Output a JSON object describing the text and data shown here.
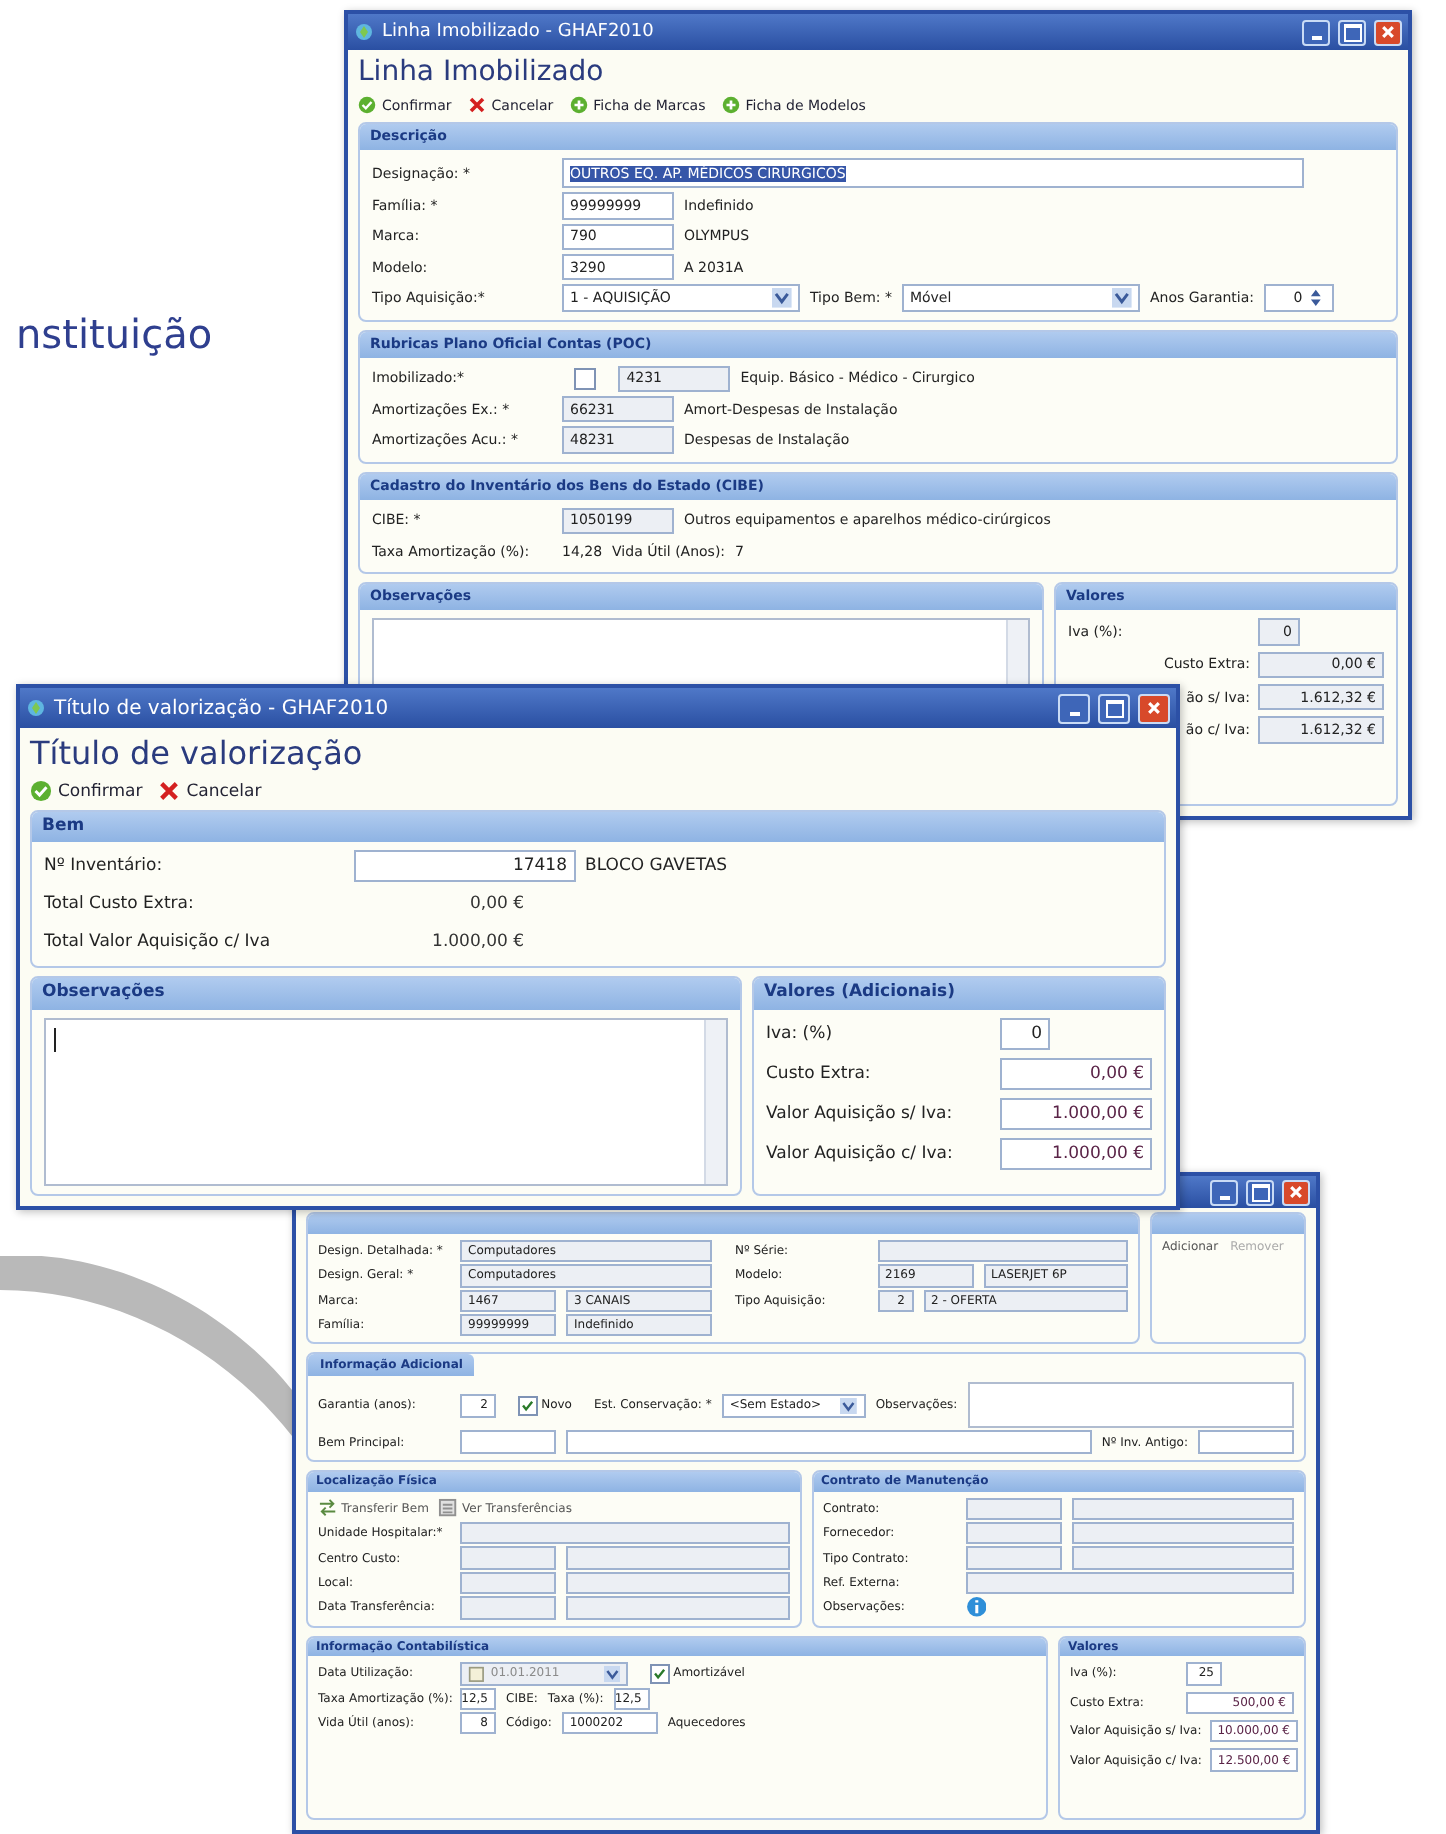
{
  "background_text": "nstituição",
  "windows": [
    {
      "title": "Linha Imobilizado - GHAF2010",
      "heading": "Linha Imobilizado",
      "toolbar": [
        {
          "kind": "confirm",
          "label": "Confirmar"
        },
        {
          "kind": "cancel",
          "label": "Cancelar"
        },
        {
          "kind": "open",
          "label": "Ficha de Marcas"
        },
        {
          "kind": "open",
          "label": "Ficha de Modelos"
        }
      ],
      "bands": [
        [
          {
            "kind": "form",
            "title": "Descrição",
            "readonly": false,
            "columns": [
              [
                [
                  {
                    "kind": "label",
                    "text": "Designação: *"
                  },
                  {
                    "kind": "input",
                    "value": "OUTROS EQ. AP. MÉDICOS CIRÚRGICOS",
                    "highlighted": true
                  }
                ],
                [
                  {
                    "kind": "label",
                    "text": "Família: *"
                  },
                  {
                    "kind": "code",
                    "value": "99999999"
                  },
                  {
                    "kind": "text",
                    "text": "Indefinido"
                  }
                ],
                [
                  {
                    "kind": "label",
                    "text": "Marca:"
                  },
                  {
                    "kind": "code",
                    "value": "790"
                  },
                  {
                    "kind": "text",
                    "text": "OLYMPUS"
                  }
                ],
                [
                  {
                    "kind": "label",
                    "text": "Modelo:"
                  },
                  {
                    "kind": "code",
                    "value": "3290"
                  },
                  {
                    "kind": "text",
                    "text": "A 2031A"
                  }
                ],
                [
                  {
                    "kind": "label",
                    "text": "Tipo Aquisição:*"
                  },
                  {
                    "kind": "select",
                    "value": "1 - AQUISIÇÃO"
                  },
                  {
                    "kind": "caption",
                    "text": "Tipo Bem: *"
                  },
                  {
                    "kind": "select",
                    "value": "Móvel"
                  },
                  {
                    "kind": "caption",
                    "text": "Anos Garantia:"
                  },
                  {
                    "kind": "spin",
                    "value": "0"
                  }
                ]
              ]
            ]
          }
        ],
        [
          {
            "kind": "form",
            "title": "Rubricas Plano Oficial Contas (POC)",
            "readonly": true,
            "columns": [
              [
                [
                  {
                    "kind": "label",
                    "text": "Imobilizado:*"
                  },
                  {
                    "kind": "check",
                    "checked": false
                  },
                  {
                    "kind": "code",
                    "value": "4231"
                  },
                  {
                    "kind": "text",
                    "text": "Equip. Básico - Médico - Cirurgico"
                  }
                ],
                [
                  {
                    "kind": "label",
                    "text": "Amortizações Ex.: *"
                  },
                  {
                    "kind": "code",
                    "value": "66231"
                  },
                  {
                    "kind": "text",
                    "text": "Amort-Despesas de Instalação"
                  }
                ],
                [
                  {
                    "kind": "label",
                    "text": "Amortizações Acu.: *"
                  },
                  {
                    "kind": "code",
                    "value": "48231"
                  },
                  {
                    "kind": "text",
                    "text": "Despesas de Instalação"
                  }
                ]
              ]
            ]
          }
        ],
        [
          {
            "kind": "form",
            "title": "Cadastro do Inventário dos Bens do Estado (CIBE)",
            "readonly": true,
            "columns": [
              [
                [
                  {
                    "kind": "label",
                    "text": "CIBE: *"
                  },
                  {
                    "kind": "code",
                    "value": "1050199"
                  },
                  {
                    "kind": "text",
                    "text": "Outros equipamentos e aparelhos médico-cirúrgicos"
                  }
                ],
                [
                  {
                    "kind": "label",
                    "text": "Taxa Amortização (%):"
                  },
                  {
                    "kind": "text",
                    "text": "14,28"
                  },
                  {
                    "kind": "caption",
                    "text": "Vida Útil (Anos):"
                  },
                  {
                    "kind": "text",
                    "text": "7"
                  }
                ]
              ]
            ]
          }
        ],
        [
          {
            "kind": "notes",
            "title": "Observações",
            "caret": false
          },
          {
            "kind": "values",
            "title": "Valores",
            "readonly": true,
            "items": [
              {
                "kind": "percent",
                "label": "Iva (%):",
                "value": "0"
              },
              {
                "kind": "money",
                "label": "Custo Extra:",
                "value": "0,00 €"
              },
              {
                "kind": "money",
                "label": "ão s/ Iva:",
                "value": "1.612,32 €"
              },
              {
                "kind": "money",
                "label": "ão c/ Iva:",
                "value": "1.612,32 €"
              }
            ]
          }
        ]
      ]
    },
    {
      "title": "Título de valorização - GHAF2010",
      "heading": "Título de valorização",
      "toolbar": [
        {
          "kind": "confirm",
          "label": "Confirmar"
        },
        {
          "kind": "cancel",
          "label": "Cancelar"
        }
      ],
      "bands": [
        [
          {
            "kind": "form",
            "title": "Bem",
            "readonly": false,
            "columns": [
              [
                [
                  {
                    "kind": "label",
                    "text": "Nº Inventário:"
                  },
                  {
                    "kind": "number",
                    "value": "17418"
                  },
                  {
                    "kind": "text",
                    "text": "BLOCO GAVETAS"
                  }
                ],
                [
                  {
                    "kind": "label",
                    "text": "Total Custo Extra:"
                  },
                  {
                    "kind": "amount",
                    "text": "0,00 €"
                  }
                ],
                [
                  {
                    "kind": "label",
                    "text": "Total Valor Aquisição c/ Iva"
                  },
                  {
                    "kind": "amount",
                    "text": "1.000,00 €"
                  }
                ]
              ]
            ]
          }
        ],
        [
          {
            "kind": "notes",
            "title": "Observações",
            "caret": true
          },
          {
            "kind": "values",
            "title": "Valores (Adicionais)",
            "readonly": false,
            "items": [
              {
                "kind": "percent",
                "label": "Iva: (%)",
                "value": "0"
              },
              {
                "kind": "money",
                "label": "Custo Extra:",
                "value": "0,00 €"
              },
              {
                "kind": "money",
                "label": "Valor Aquisição s/ Iva:",
                "value": "1.000,00 €"
              },
              {
                "kind": "money",
                "label": "Valor Aquisição c/ Iva:",
                "value": "1.000,00 €"
              }
            ]
          }
        ]
      ]
    },
    {
      "bands": [
        [
          {
            "kind": "form",
            "readonly": true,
            "columns": [
              [
                [
                  {
                    "kind": "label",
                    "text": "Design. Detalhada: *"
                  },
                  {
                    "kind": "input",
                    "value": "Computadores"
                  }
                ],
                [
                  {
                    "kind": "label",
                    "text": "Design. Geral: *"
                  },
                  {
                    "kind": "input",
                    "value": "Computadores"
                  }
                ],
                [
                  {
                    "kind": "label",
                    "text": "Marca:"
                  },
                  {
                    "kind": "code",
                    "value": "1467"
                  },
                  {
                    "kind": "input",
                    "value": "3 CANAIS"
                  }
                ],
                [
                  {
                    "kind": "label",
                    "text": "Família:"
                  },
                  {
                    "kind": "code",
                    "value": "99999999"
                  },
                  {
                    "kind": "input",
                    "value": "Indefinido"
                  }
                ]
              ],
              [
                [
                  {
                    "kind": "label",
                    "text": "Nº Série:"
                  },
                  {
                    "kind": "input"
                  }
                ],
                [
                  {
                    "kind": "label",
                    "text": "Modelo:"
                  },
                  {
                    "kind": "code",
                    "value": "2169"
                  },
                  {
                    "kind": "input",
                    "value": "LASERJET 6P"
                  }
                ],
                [
                  {
                    "kind": "label",
                    "text": "Tipo Aquisição:"
                  },
                  {
                    "kind": "short",
                    "value": "2"
                  },
                  {
                    "kind": "input",
                    "value": "2 - OFERTA"
                  }
                ]
              ]
            ]
          },
          {
            "kind": "attachments",
            "actions": [
              {
                "label": "Adicionar",
                "disabled": false
              },
              {
                "label": "Remover",
                "disabled": true
              }
            ]
          }
        ],
        [
          {
            "kind": "tab",
            "title": "Informação Adicional",
            "readonly": false,
            "columns": [
              [
                [
                  {
                    "kind": "label",
                    "text": "Garantia (anos):"
                  },
                  {
                    "kind": "short",
                    "value": "2"
                  },
                  {
                    "kind": "check",
                    "checked": true,
                    "label": "Novo"
                  },
                  {
                    "kind": "caption",
                    "text": "Est. Conservação: *"
                  },
                  {
                    "kind": "select",
                    "value": "<Sem Estado>"
                  },
                  {
                    "kind": "caption",
                    "text": "Observações:"
                  },
                  {
                    "kind": "memo"
                  }
                ],
                [
                  {
                    "kind": "label",
                    "text": "Bem Principal:"
                  },
                  {
                    "kind": "code"
                  },
                  {
                    "kind": "input"
                  },
                  {
                    "kind": "caption",
                    "text": "Nº Inv. Antigo:"
                  },
                  {
                    "kind": "code"
                  }
                ]
              ]
            ]
          }
        ],
        [
          {
            "kind": "form",
            "title": "Localização Física",
            "readonly": true,
            "columns": [
              [
                [
                  {
                    "kind": "transfer",
                    "text": "Transferir Bem"
                  },
                  {
                    "kind": "history",
                    "text": "Ver Transferências"
                  }
                ],
                [
                  {
                    "kind": "label",
                    "text": "Unidade Hospitalar:*"
                  },
                  {
                    "kind": "input"
                  }
                ],
                [
                  {
                    "kind": "label",
                    "text": "Centro Custo:"
                  },
                  {
                    "kind": "code"
                  },
                  {
                    "kind": "input"
                  }
                ],
                [
                  {
                    "kind": "label",
                    "text": "Local:"
                  },
                  {
                    "kind": "code"
                  },
                  {
                    "kind": "input"
                  }
                ],
                [
                  {
                    "kind": "label",
                    "text": "Data Transferência:"
                  },
                  {
                    "kind": "code"
                  },
                  {
                    "kind": "input"
                  }
                ]
              ]
            ]
          },
          {
            "kind": "form",
            "title": "Contrato de Manutenção",
            "readonly": true,
            "columns": [
              [
                [
                  {
                    "kind": "label",
                    "text": "Contrato:"
                  },
                  {
                    "kind": "code"
                  },
                  {
                    "kind": "input"
                  }
                ],
                [
                  {
                    "kind": "label",
                    "text": "Fornecedor:"
                  },
                  {
                    "kind": "code"
                  },
                  {
                    "kind": "input"
                  }
                ],
                [
                  {
                    "kind": "label",
                    "text": "Tipo Contrato:"
                  },
                  {
                    "kind": "code"
                  },
                  {
                    "kind": "input"
                  }
                ],
                [
                  {
                    "kind": "label",
                    "text": "Ref. Externa:"
                  },
                  {
                    "kind": "input"
                  }
                ],
                [
                  {
                    "kind": "label",
                    "text": "Observações:"
                  },
                  {
                    "kind": "info"
                  }
                ]
              ]
            ]
          }
        ],
        [
          {
            "kind": "form",
            "title": "Informação Contabilística",
            "readonly": false,
            "columns": [
              [
                [
                  {
                    "kind": "label",
                    "text": "Data Utilização:"
                  },
                  {
                    "kind": "date",
                    "value": "01.01.2011",
                    "disabled": true
                  },
                  {
                    "kind": "check",
                    "checked": true,
                    "label": "Amortizável"
                  }
                ],
                [
                  {
                    "kind": "label",
                    "text": "Taxa Amortização (%):"
                  },
                  {
                    "kind": "short",
                    "value": "12,5"
                  },
                  {
                    "kind": "caption",
                    "text": "CIBE:"
                  },
                  {
                    "kind": "caption",
                    "text": "Taxa (%):"
                  },
                  {
                    "kind": "short",
                    "value": "12,5"
                  }
                ],
                [
                  {
                    "kind": "label",
                    "text": "Vida Útil (anos):"
                  },
                  {
                    "kind": "short",
                    "value": "8"
                  },
                  {
                    "kind": "caption",
                    "text": "Código:"
                  },
                  {
                    "kind": "code",
                    "value": "1000202"
                  },
                  {
                    "kind": "text",
                    "text": "Aquecedores"
                  }
                ]
              ]
            ]
          },
          {
            "kind": "values",
            "title": "Valores",
            "readonly": false,
            "items": [
              {
                "kind": "percent",
                "label": "Iva (%):",
                "value": "25"
              },
              {
                "kind": "money",
                "label": "Custo Extra:",
                "value": "500,00 €"
              },
              {
                "kind": "money",
                "label": "Valor Aquisição s/ Iva:",
                "value": "10.000,00 €"
              },
              {
                "kind": "money",
                "label": "Valor Aquisição c/ Iva:",
                "value": "12.500,00 €"
              }
            ]
          }
        ]
      ]
    }
  ]
}
